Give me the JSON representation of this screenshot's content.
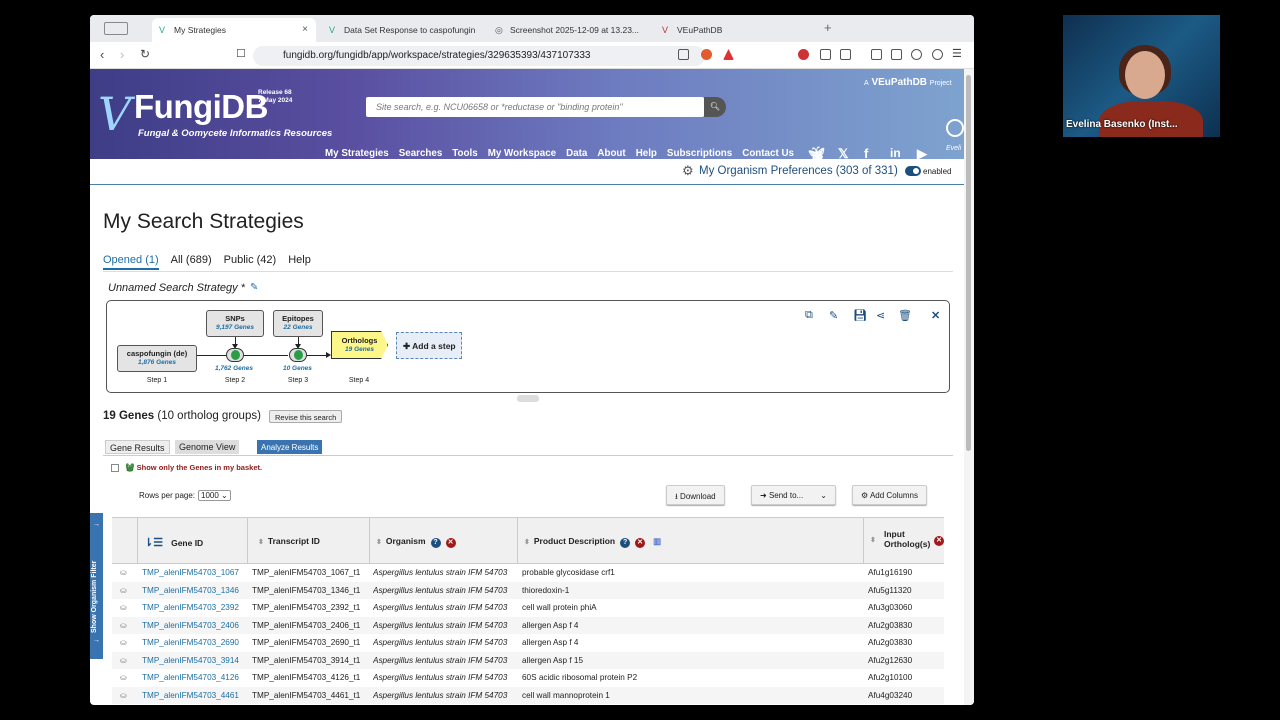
{
  "browser": {
    "tabs": [
      {
        "title": "My Strategies",
        "icon": "V"
      },
      {
        "title": "Data Set Response to caspofungin",
        "icon": "V"
      },
      {
        "title": "Screenshot 2025-12-09 at 13.23...",
        "icon": "◎"
      },
      {
        "title": "VEuPathDB",
        "icon": "V"
      }
    ],
    "new_tab": "+",
    "url": "fungidb.org/fungidb/app/workspace/strategies/329635393/437107333"
  },
  "site": {
    "logo": "FungiDB",
    "release": "Release 68",
    "release_date": "7 May 2024",
    "tagline": "Fungal & Oomycete Informatics Resources",
    "search_placeholder": "Site search, e.g. NCU06658 or *reductase or \"binding protein\"",
    "vepu_prefix": "A",
    "vepu": "VEuPathDB",
    "vepu_suffix": "Project",
    "nav": [
      "My Strategies",
      "Searches",
      "Tools",
      "My Workspace",
      "Data",
      "About",
      "Help",
      "Subscriptions",
      "Contact Us"
    ],
    "user_short": "Eveli"
  },
  "prefs": {
    "label": "My Organism Preferences (303 of 331)",
    "toggle": "enabled"
  },
  "page": {
    "title": "My Search Strategies",
    "tabs": [
      "Opened (1)",
      "All (689)",
      "Public (42)",
      "Help"
    ],
    "strategy_name": "Unnamed Search Strategy *"
  },
  "strategy": {
    "step1": {
      "name": "caspofungin (de)",
      "count": "1,876 Genes",
      "label": "Step 1"
    },
    "step2": {
      "name": "SNPs",
      "count": "9,197 Genes",
      "result": "1,762 Genes",
      "label": "Step 2"
    },
    "step3": {
      "name": "Epitopes",
      "count": "22 Genes",
      "result": "10 Genes",
      "label": "Step 3"
    },
    "step4": {
      "name": "Orthologs",
      "count": "19 Genes",
      "label": "Step 4"
    },
    "add_step": "Add a step"
  },
  "results": {
    "count": "19 Genes",
    "groups": "(10 ortholog groups)",
    "revise": "Revise this search",
    "tabs": [
      "Gene Results",
      "Genome View",
      "Analyze Results"
    ],
    "basket_filter": "Show only the Genes in my basket.",
    "rows_per_page_label": "Rows per page:",
    "rows_per_page": "1000",
    "download": "Download",
    "send_to": "Send to...",
    "add_columns": "Add Columns",
    "organism_filter": "Show Organism Filter"
  },
  "table": {
    "headers": [
      "Gene ID",
      "Transcript ID",
      "Organism",
      "Product Description",
      "Input Ortholog(s)"
    ],
    "rows": [
      {
        "gene": "TMP_alenIFM54703_1067",
        "transcript": "TMP_alenIFM54703_1067_t1",
        "organism": "Aspergillus lentulus strain IFM 54703",
        "product": "probable glycosidase crf1",
        "input": "Afu1g16190"
      },
      {
        "gene": "TMP_alenIFM54703_1346",
        "transcript": "TMP_alenIFM54703_1346_t1",
        "organism": "Aspergillus lentulus strain IFM 54703",
        "product": "thioredoxin-1",
        "input": "Afu5g11320"
      },
      {
        "gene": "TMP_alenIFM54703_2392",
        "transcript": "TMP_alenIFM54703_2392_t1",
        "organism": "Aspergillus lentulus strain IFM 54703",
        "product": "cell wall protein phiA",
        "input": "Afu3g03060"
      },
      {
        "gene": "TMP_alenIFM54703_2406",
        "transcript": "TMP_alenIFM54703_2406_t1",
        "organism": "Aspergillus lentulus strain IFM 54703",
        "product": "allergen Asp f 4",
        "input": "Afu2g03830"
      },
      {
        "gene": "TMP_alenIFM54703_2690",
        "transcript": "TMP_alenIFM54703_2690_t1",
        "organism": "Aspergillus lentulus strain IFM 54703",
        "product": "allergen Asp f 4",
        "input": "Afu2g03830"
      },
      {
        "gene": "TMP_alenIFM54703_3914",
        "transcript": "TMP_alenIFM54703_3914_t1",
        "organism": "Aspergillus lentulus strain IFM 54703",
        "product": "allergen Asp f 15",
        "input": "Afu2g12630"
      },
      {
        "gene": "TMP_alenIFM54703_4126",
        "transcript": "TMP_alenIFM54703_4126_t1",
        "organism": "Aspergillus lentulus strain IFM 54703",
        "product": "60S acidic ribosomal protein P2",
        "input": "Afu2g10100"
      },
      {
        "gene": "TMP_alenIFM54703_4461",
        "transcript": "TMP_alenIFM54703_4461_t1",
        "organism": "Aspergillus lentulus strain IFM 54703",
        "product": "cell wall mannoprotein 1",
        "input": "Afu4g03240"
      }
    ]
  },
  "video": {
    "name": "Evelina Basenko (Inst..."
  },
  "colors": {
    "accent": "#1d6fa5",
    "header": "#4b4a93",
    "analyze": "#3a74b0",
    "remove": "#a01818"
  }
}
